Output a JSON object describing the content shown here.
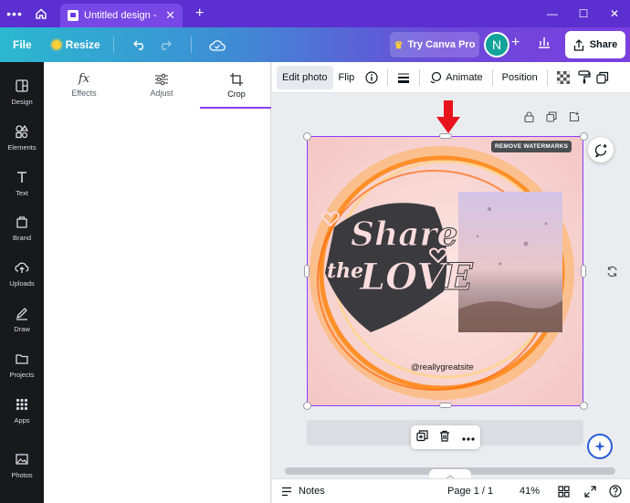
{
  "browser": {
    "tab_title": "Untitled design - In...",
    "tab_close": "✕",
    "new_tab": "+",
    "menu_dots": "•••",
    "window_controls": [
      "—",
      "☐",
      "✕"
    ]
  },
  "toolbar": {
    "file_label": "File",
    "resize_label": "Resize",
    "try_pro_label": "Try Canva Pro",
    "avatar_initial": "N",
    "add_label": "+",
    "share_label": "Share"
  },
  "rail": [
    {
      "label": "Design",
      "icon": "design-icon"
    },
    {
      "label": "Elements",
      "icon": "elements-icon"
    },
    {
      "label": "Text",
      "icon": "text-icon"
    },
    {
      "label": "Brand",
      "icon": "brand-icon"
    },
    {
      "label": "Uploads",
      "icon": "uploads-icon"
    },
    {
      "label": "Draw",
      "icon": "draw-icon"
    },
    {
      "label": "Projects",
      "icon": "projects-icon"
    },
    {
      "label": "Apps",
      "icon": "apps-icon"
    },
    {
      "label": "Photos",
      "icon": "photos-icon"
    }
  ],
  "panel": {
    "tabs": [
      {
        "label": "Effects",
        "glyph": "fx"
      },
      {
        "label": "Adjust"
      },
      {
        "label": "Crop"
      }
    ],
    "active_tab": "Crop"
  },
  "context_toolbar": {
    "edit_photo": "Edit photo",
    "flip": "Flip",
    "animate": "Animate",
    "position": "Position"
  },
  "canvas": {
    "remove_watermarks": "REMOVE WATERMARKS",
    "handle_text": "@reallygreatsite",
    "art_text_line1": "Share",
    "art_text_line2": "the",
    "art_text_line3": "LOVE"
  },
  "footer": {
    "notes_label": "Notes",
    "page_label": "Page 1 / 1",
    "zoom_label": "41%"
  },
  "colors": {
    "accent": "#8b3dff",
    "annotation_arrow": "#e8141b",
    "rail_bg": "#18191b"
  }
}
